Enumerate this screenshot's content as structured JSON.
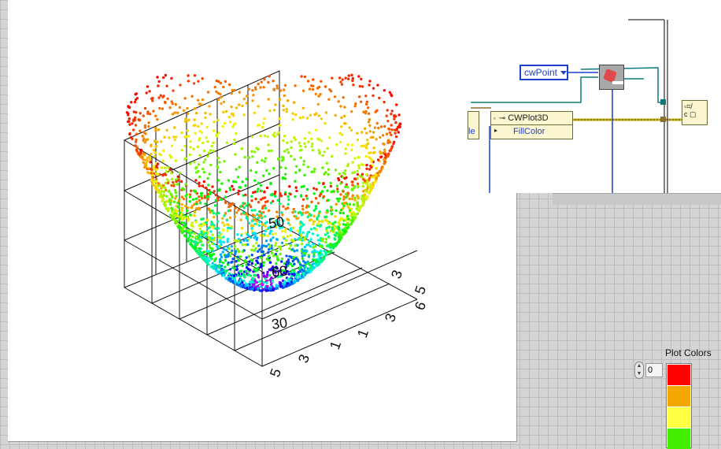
{
  "plot": {
    "tick_labels": [
      {
        "text": "3"
      },
      {
        "text": "5"
      },
      {
        "text": "3"
      },
      {
        "text": "6"
      },
      {
        "text": "1"
      },
      {
        "text": "1"
      },
      {
        "text": "30"
      },
      {
        "text": "3"
      },
      {
        "text": "5"
      },
      {
        "text": "50"
      },
      {
        "text": "60"
      }
    ]
  },
  "block_diagram": {
    "enum_constant": "cwPoint",
    "property_node": {
      "class": "CWPlot3D",
      "property": "FillColor"
    },
    "partial_node_label": "le"
  },
  "front_panel": {
    "plot_colors_label": "Plot Colors",
    "index_value": "0",
    "swatches": [
      {
        "color": "#ff0000"
      },
      {
        "color": "#f2a800"
      },
      {
        "color": "#ffff44"
      },
      {
        "color": "#44ee00"
      }
    ]
  }
}
